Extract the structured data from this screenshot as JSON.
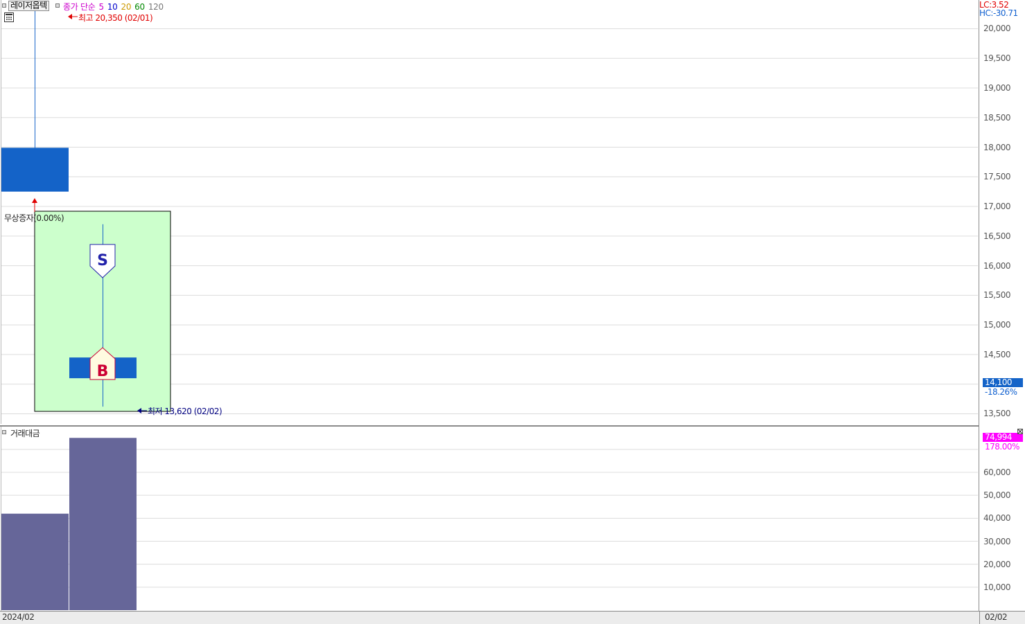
{
  "header": {
    "stock_name": "레이저옵텍",
    "ma_title": "종가 단순",
    "ma_periods": [
      {
        "label": "5",
        "color": "#cc00cc"
      },
      {
        "label": "10",
        "color": "#0000cc"
      },
      {
        "label": "20",
        "color": "#cc9900"
      },
      {
        "label": "60",
        "color": "#008800"
      },
      {
        "label": "120",
        "color": "#777777"
      }
    ],
    "ma_title_color": "#cc00cc"
  },
  "price_axis": {
    "lc": "LC:3.52",
    "hc": "HC:-30.71",
    "ticks": [
      "20,000",
      "19,500",
      "19,000",
      "18,500",
      "18,000",
      "17,500",
      "17,000",
      "16,500",
      "16,000",
      "15,500",
      "15,000",
      "14,500",
      "13,500"
    ],
    "current_price": "14,100",
    "current_change": "-18.26%"
  },
  "volume_axis": {
    "ticks": [
      "60,000",
      "50,000",
      "40,000",
      "30,000",
      "20,000",
      "10,000"
    ],
    "current_value": "74,994",
    "current_change": "178.00%"
  },
  "annotations": {
    "high": "최고 20,350 (02/01)",
    "low": "최저 13,620 (02/02)",
    "event": "무상증자(0.00%)",
    "sell_marker": "S",
    "buy_marker": "B"
  },
  "volume_pane": {
    "title": "거래대금"
  },
  "footer": {
    "start_date": "2024/02",
    "end_date": "02/02"
  },
  "colors": {
    "candle_down": "#1463c8",
    "volume_bar": "#666699",
    "highlight_box": "#ccffcc",
    "buy_marker": "#cc0033",
    "sell_marker": "#2222aa"
  },
  "chart_data": [
    {
      "type": "candlestick",
      "x": [
        "02/01",
        "02/02"
      ],
      "open": [
        17990,
        14450
      ],
      "high": [
        20350,
        16700
      ],
      "low": [
        17250,
        13620
      ],
      "close": [
        17250,
        14100
      ],
      "ylim": [
        13400,
        20300
      ]
    },
    {
      "type": "bar",
      "title": "거래대금",
      "categories": [
        "02/01",
        "02/02"
      ],
      "values": [
        42000,
        74994
      ],
      "ylim": [
        0,
        75000
      ]
    }
  ]
}
